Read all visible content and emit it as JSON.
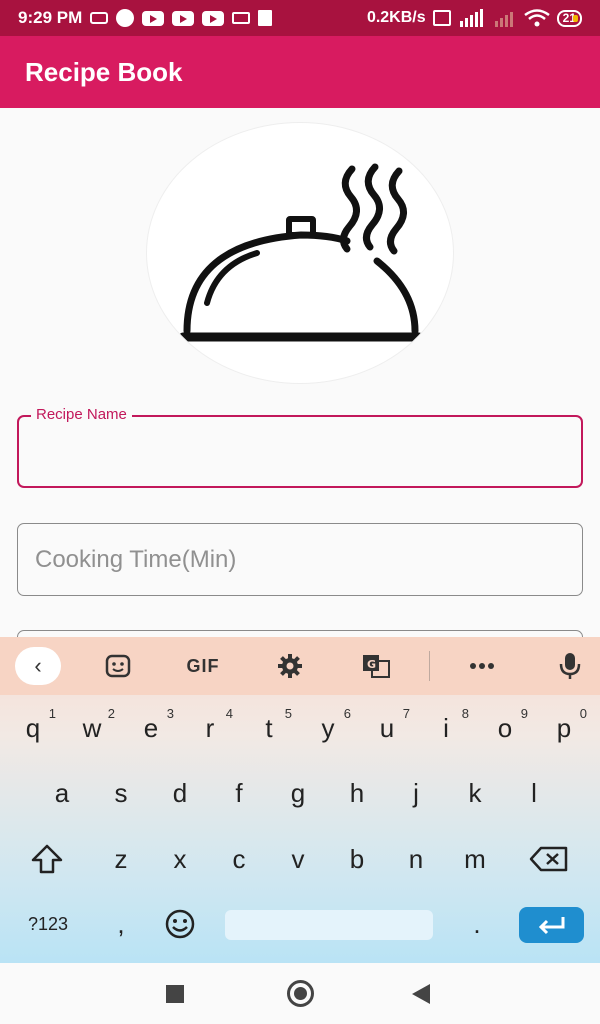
{
  "status_bar": {
    "time": "9:29 PM",
    "net_speed": "0.2KB/s",
    "battery": "21"
  },
  "app_bar": {
    "title": "Recipe Book"
  },
  "form": {
    "recipe_name_label": "Recipe Name",
    "cooking_time_placeholder": "Cooking Time(Min)"
  },
  "keyboard": {
    "toolbar": {
      "gif_label": "GIF"
    },
    "row1": [
      {
        "k": "q",
        "h": "1"
      },
      {
        "k": "w",
        "h": "2"
      },
      {
        "k": "e",
        "h": "3"
      },
      {
        "k": "r",
        "h": "4"
      },
      {
        "k": "t",
        "h": "5"
      },
      {
        "k": "y",
        "h": "6"
      },
      {
        "k": "u",
        "h": "7"
      },
      {
        "k": "i",
        "h": "8"
      },
      {
        "k": "o",
        "h": "9"
      },
      {
        "k": "p",
        "h": "0"
      }
    ],
    "row2": [
      "a",
      "s",
      "d",
      "f",
      "g",
      "h",
      "j",
      "k",
      "l"
    ],
    "row3": [
      "z",
      "x",
      "c",
      "v",
      "b",
      "n",
      "m"
    ],
    "symbols_label": "?123",
    "comma": ",",
    "period": "."
  },
  "colors": {
    "status_bar": "#a8123f",
    "app_bar": "#d81b60",
    "accent": "#c2185b",
    "enter_key": "#1f8ecf"
  },
  "icons": [
    "dish-cloche-icon",
    "sticker-icon",
    "settings-gear-icon",
    "translate-icon",
    "more-icon",
    "mic-icon",
    "shift-icon",
    "backspace-icon",
    "emoji-icon",
    "enter-icon"
  ]
}
